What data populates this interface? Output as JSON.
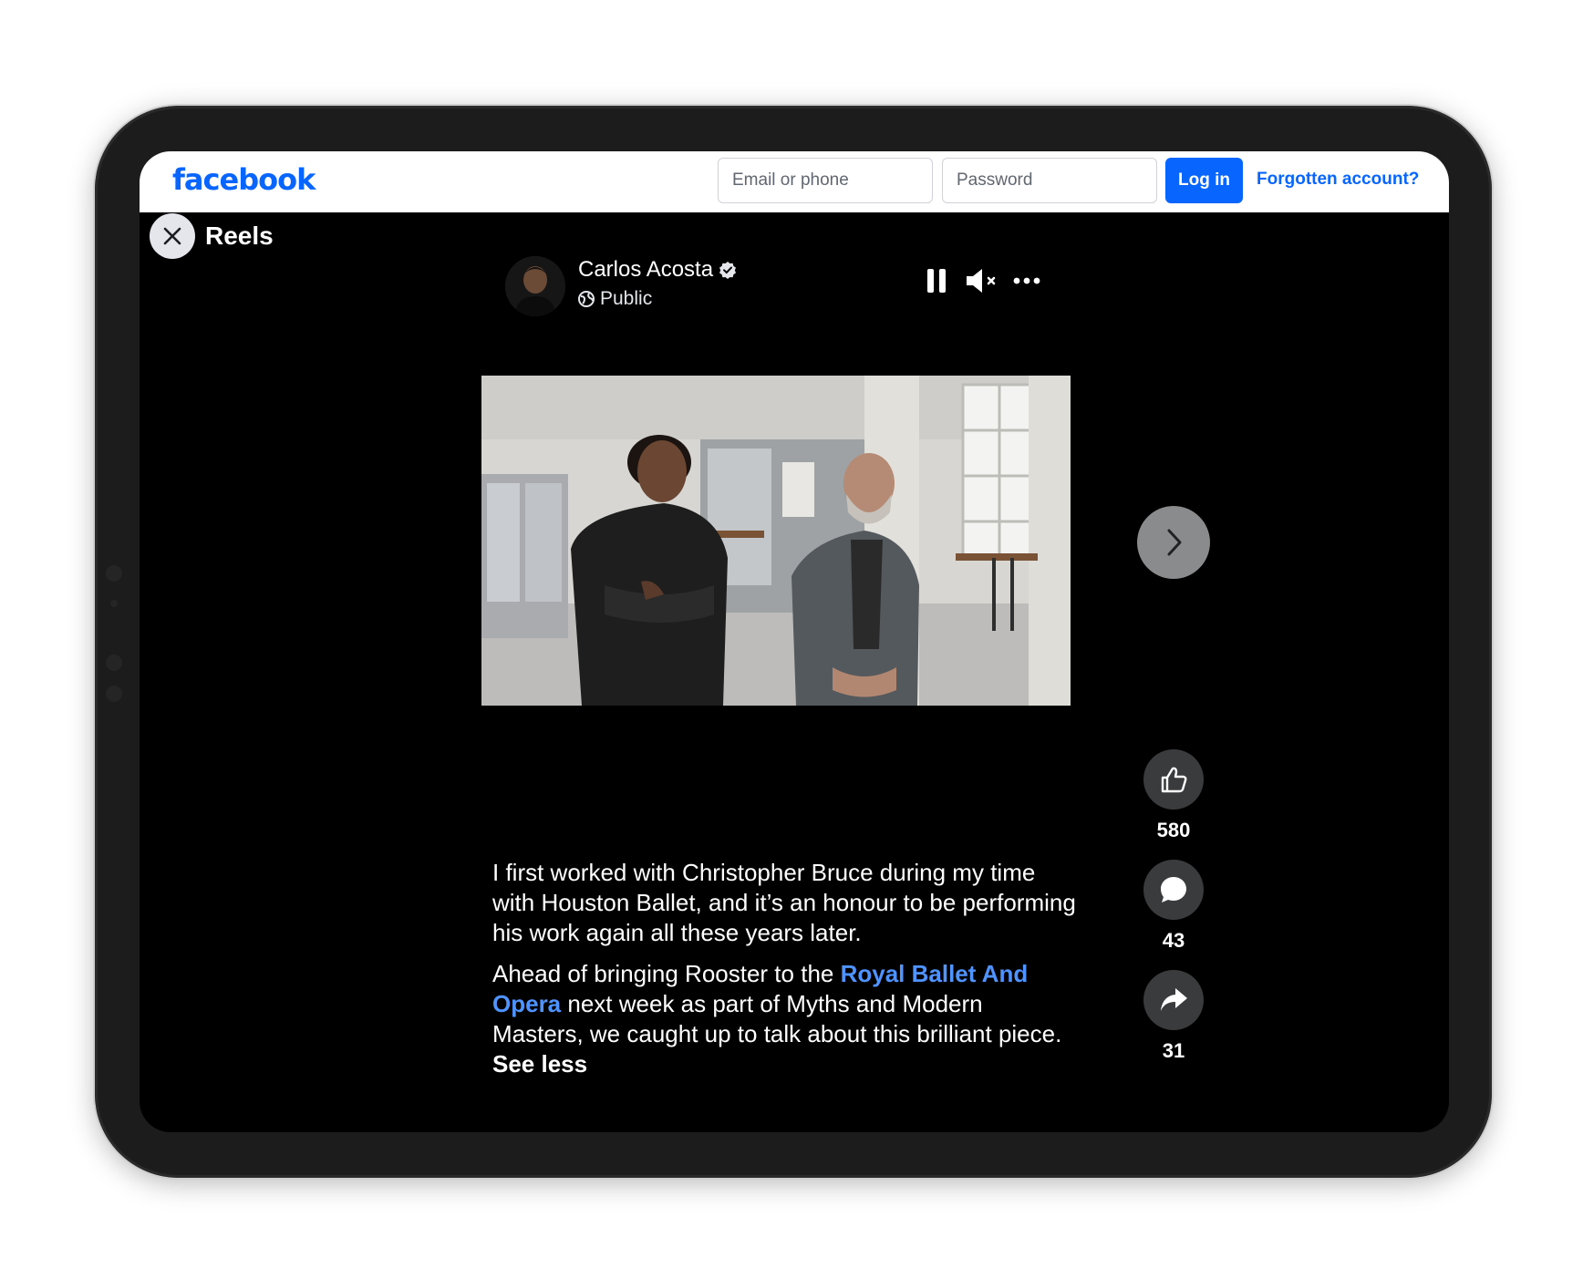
{
  "header": {
    "logo": "facebook",
    "email_placeholder": "Email or phone",
    "password_placeholder": "Password",
    "login_label": "Log in",
    "forgot_label": "Forgotten account?"
  },
  "reels": {
    "title": "Reels"
  },
  "post": {
    "author": "Carlos Acosta",
    "privacy": "Public",
    "caption_p1": "I first worked with Christopher Bruce during my time with Houston Ballet, and it’s an honour to be performing his work again all these years later.",
    "caption_p2_a": "Ahead of bringing Rooster to the ",
    "caption_p2_mention": "Royal Ballet And Opera",
    "caption_p2_b": " next week as part of Myths and Modern Masters, we caught up to talk about this brilliant piece. ",
    "see_less": "See less"
  },
  "actions": {
    "likes": "580",
    "comments": "43",
    "shares": "31"
  },
  "icons": [
    "close-icon",
    "verified-icon",
    "globe-icon",
    "pause-icon",
    "mute-icon",
    "more-icon",
    "chevron-right-icon",
    "like-icon",
    "comment-icon",
    "share-icon"
  ],
  "colors": {
    "brand": "#0866ff",
    "mention": "#4f93ff",
    "background": "#000000"
  }
}
